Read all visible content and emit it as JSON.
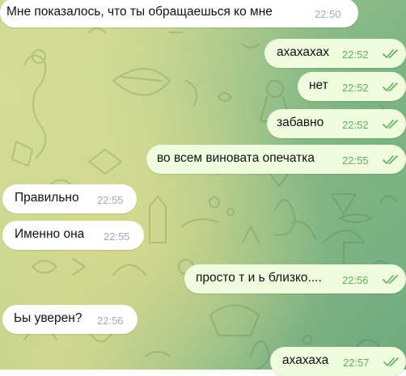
{
  "colors": {
    "incoming_bubble": "#ffffff",
    "outgoing_bubble": "#effdde",
    "time_incoming": "#a0acb6",
    "time_outgoing": "#5fb25a",
    "check_marks": "#5fb25a"
  },
  "messages": [
    {
      "direction": "incoming",
      "text": "Мне показалось, что ты обращаешься ко мне",
      "time": "22:50"
    },
    {
      "direction": "outgoing",
      "text": "ахахахах",
      "time": "22:52",
      "status": "read",
      "status_icon": "double-check-icon"
    },
    {
      "direction": "outgoing",
      "text": "нет",
      "time": "22:52",
      "status": "read",
      "status_icon": "double-check-icon"
    },
    {
      "direction": "outgoing",
      "text": "забавно",
      "time": "22:52",
      "status": "read",
      "status_icon": "double-check-icon"
    },
    {
      "direction": "outgoing",
      "text": "во всем виновата опечатка",
      "time": "22:55",
      "status": "read",
      "status_icon": "double-check-icon"
    },
    {
      "direction": "incoming",
      "text": "Правильно",
      "time": "22:55"
    },
    {
      "direction": "incoming",
      "text": "Именно она",
      "time": "22:55"
    },
    {
      "direction": "outgoing",
      "text": "просто т и ь близко....",
      "time": "22:56",
      "status": "read",
      "status_icon": "double-check-icon"
    },
    {
      "direction": "incoming",
      "text": "Ьы уверен?",
      "time": "22:56"
    },
    {
      "direction": "outgoing",
      "text": "ахахаха",
      "time": "22:57",
      "status": "read",
      "status_icon": "double-check-icon"
    }
  ]
}
